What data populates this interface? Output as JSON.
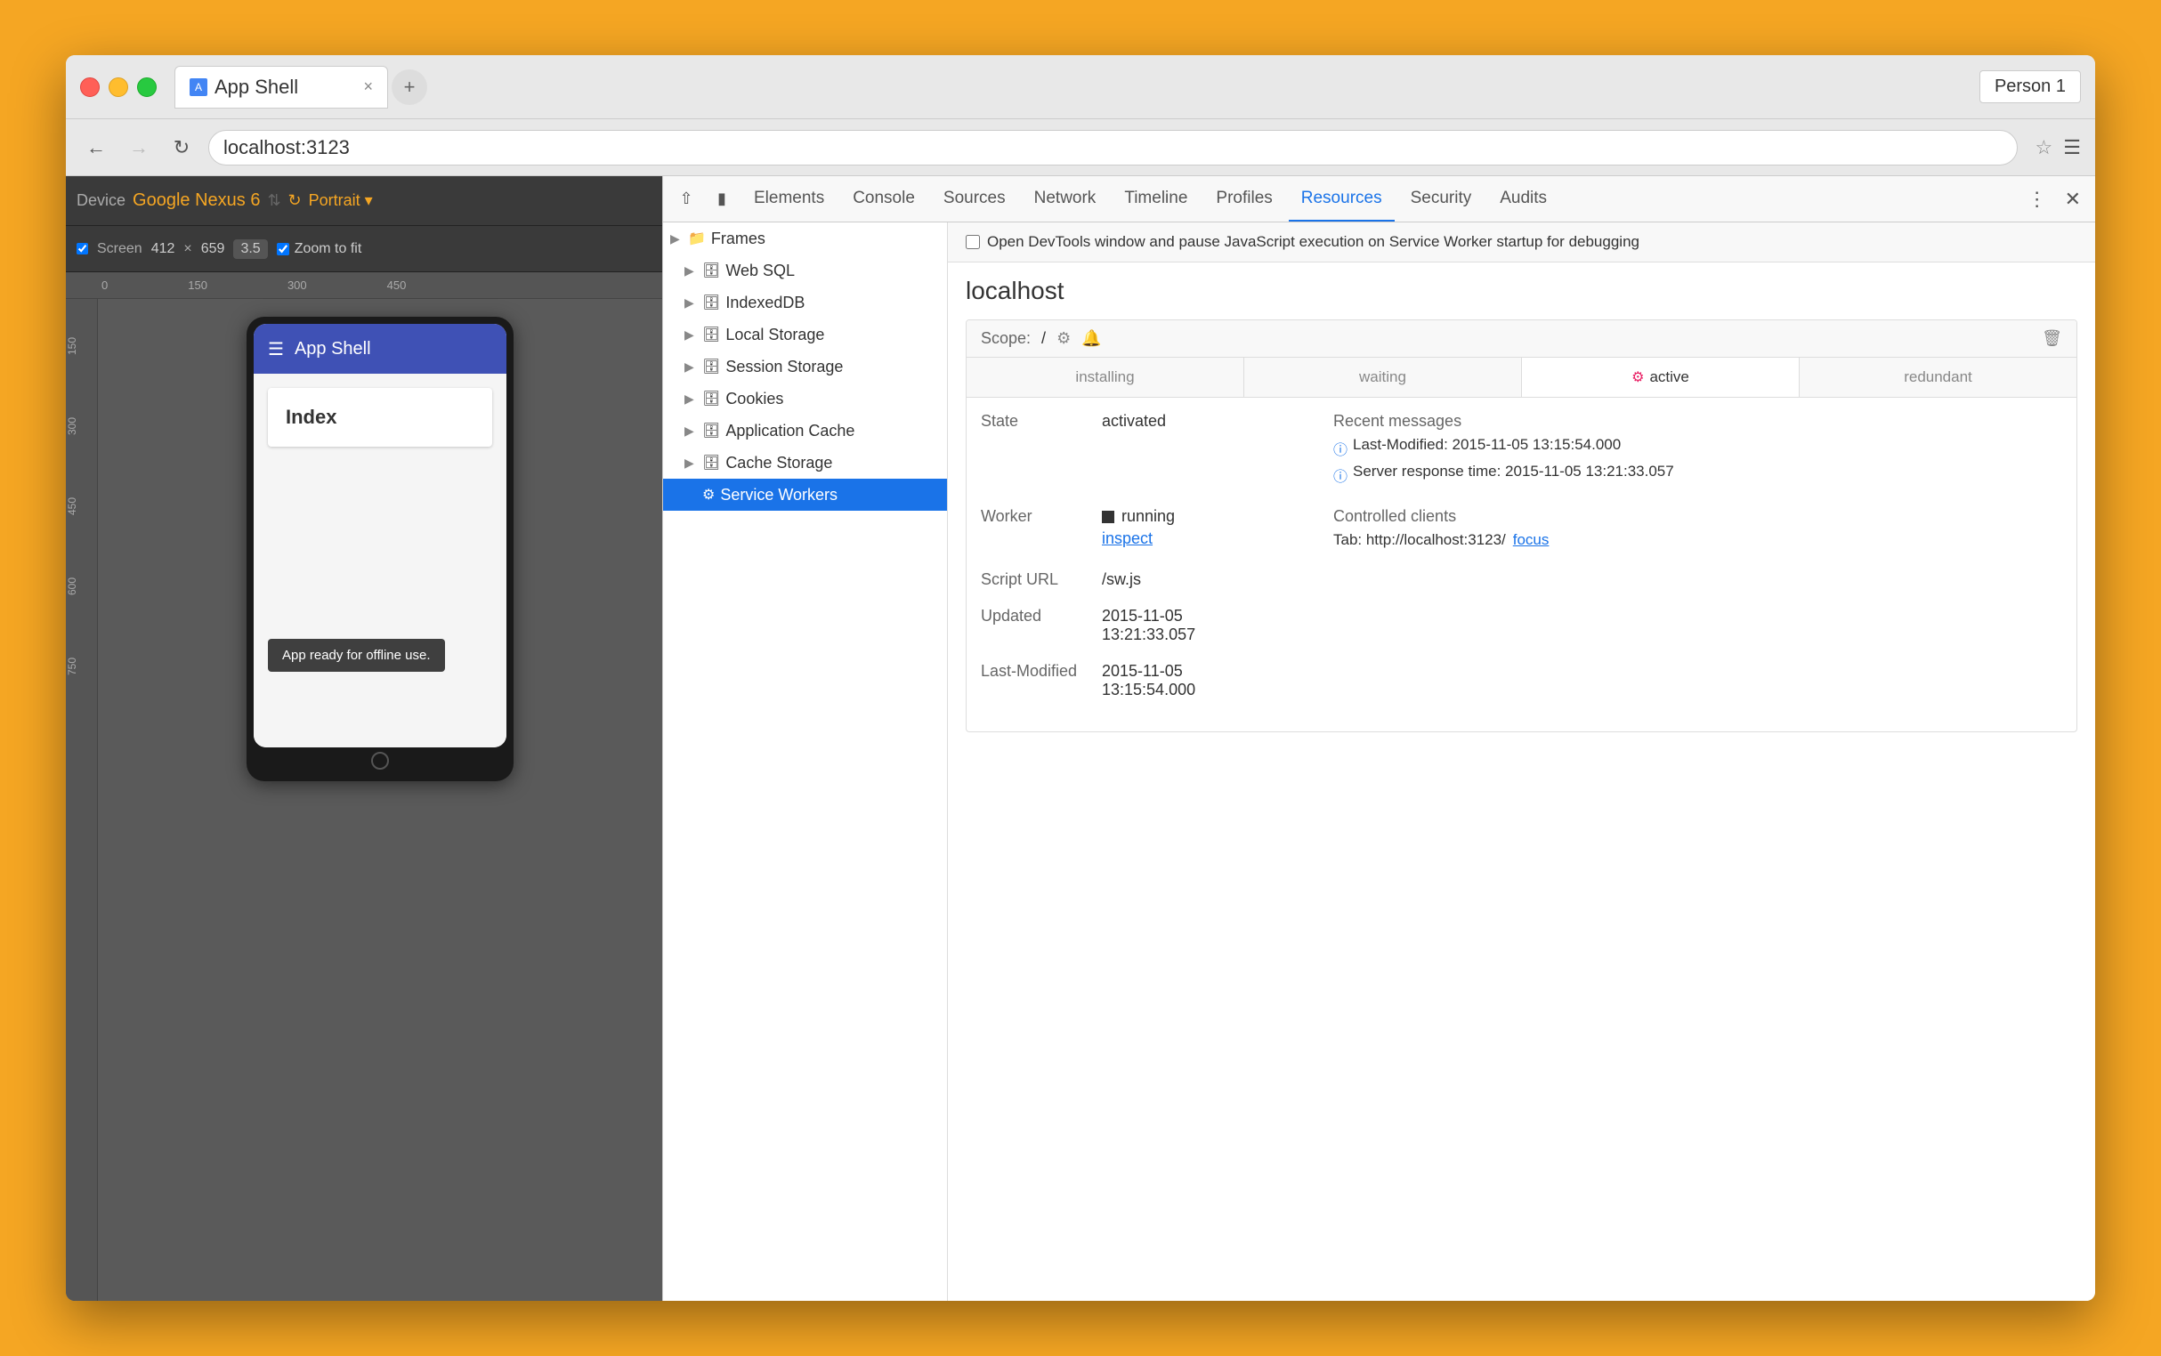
{
  "browser": {
    "tab_label": "App Shell",
    "tab_close": "×",
    "address": "localhost:3123",
    "profile": "Person 1"
  },
  "device_toolbar": {
    "device_label": "Device",
    "device_name": "Google Nexus 6",
    "rotate_icon": "⟳",
    "portrait_label": "Portrait ▾",
    "screen_label": "Screen",
    "width": "412",
    "x_label": "×",
    "height": "659",
    "dpr": "3.5",
    "zoom_label": "Zoom to fit",
    "ruler_nums": [
      "0",
      "150",
      "300",
      "450"
    ],
    "ruler_left_nums": [
      "150",
      "300",
      "450",
      "600",
      "750"
    ]
  },
  "phone": {
    "app_title": "App Shell",
    "index_title": "Index",
    "toast": "App ready for offline use."
  },
  "devtools": {
    "tabs": [
      "Elements",
      "Console",
      "Sources",
      "Network",
      "Timeline",
      "Profiles",
      "Resources",
      "Security",
      "Audits"
    ],
    "active_tab": "Resources"
  },
  "resources_tree": {
    "items": [
      {
        "id": "frames",
        "label": "Frames",
        "indent": 0,
        "arrow": "▶",
        "icon": "📁",
        "selected": false
      },
      {
        "id": "websql",
        "label": "Web SQL",
        "indent": 1,
        "arrow": "▶",
        "icon": "🗄",
        "selected": false
      },
      {
        "id": "indexeddb",
        "label": "IndexedDB",
        "indent": 1,
        "arrow": "▶",
        "icon": "🗄",
        "selected": false
      },
      {
        "id": "localstorage",
        "label": "Local Storage",
        "indent": 1,
        "arrow": "▶",
        "icon": "🗄",
        "selected": false
      },
      {
        "id": "sessionstorage",
        "label": "Session Storage",
        "indent": 1,
        "arrow": "▶",
        "icon": "🗄",
        "selected": false
      },
      {
        "id": "cookies",
        "label": "Cookies",
        "indent": 1,
        "arrow": "▶",
        "icon": "🗄",
        "selected": false
      },
      {
        "id": "appcache",
        "label": "Application Cache",
        "indent": 1,
        "arrow": "▶",
        "icon": "🗄",
        "selected": false
      },
      {
        "id": "cachestorage",
        "label": "Cache Storage",
        "indent": 1,
        "arrow": "▶",
        "icon": "🗄",
        "selected": false
      },
      {
        "id": "serviceworkers",
        "label": "Service Workers",
        "indent": 1,
        "arrow": "",
        "icon": "⚙",
        "selected": true
      }
    ]
  },
  "service_worker": {
    "notice": "Open DevTools window and pause JavaScript execution on Service Worker startup for debugging",
    "host": "localhost",
    "scope_label": "Scope:",
    "scope_value": "/",
    "status_tabs": [
      "installing",
      "waiting",
      "active",
      "redundant"
    ],
    "active_tab_index": 2,
    "active_icon": "⚙",
    "state_key": "State",
    "state_value": "activated",
    "worker_key": "Worker",
    "worker_running": "running",
    "worker_inspect": "inspect",
    "script_key": "Script URL",
    "script_value": "/sw.js",
    "updated_key": "Updated",
    "updated_value": "2015-11-05\n13:21:33.057",
    "last_modified_key": "Last-Modified",
    "last_modified_value": "2015-11-05\n13:15:54.000",
    "recent_messages_label": "Recent messages",
    "message1": "Last-Modified: 2015-11-05 13:15:54.000",
    "message2": "Server response time: 2015-11-05 13:21:33.057",
    "controlled_clients_label": "Controlled clients",
    "client_tab_label": "Tab: http://localhost:3123/",
    "client_focus_link": "focus",
    "delete_icon": "🗑"
  }
}
